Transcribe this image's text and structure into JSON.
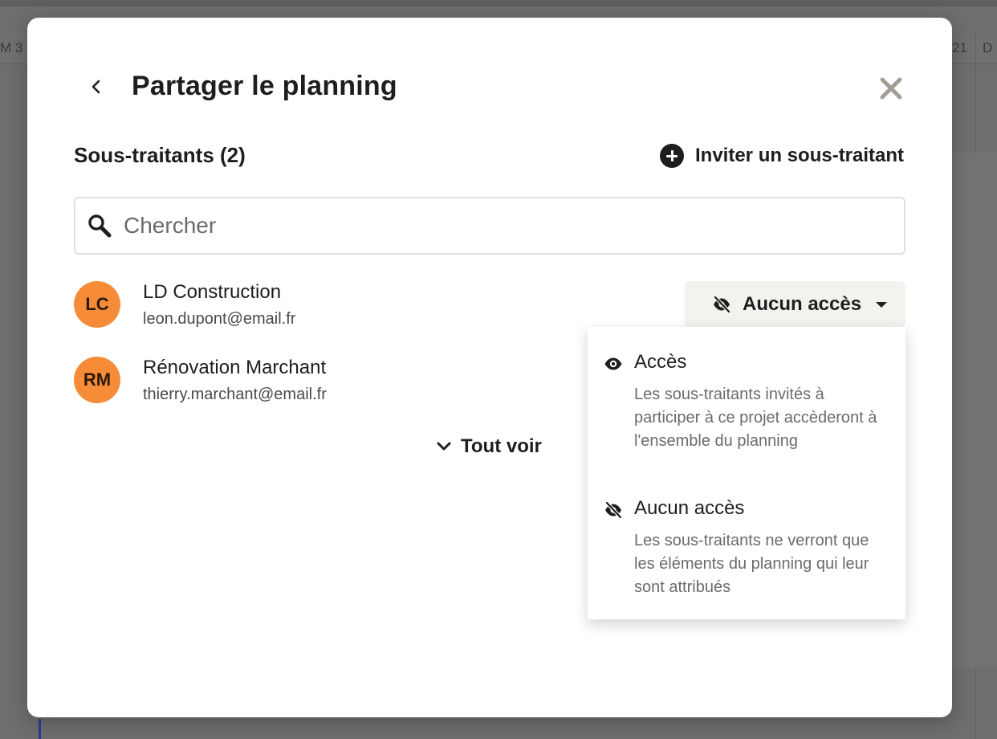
{
  "background": {
    "day_left": "M 3",
    "day_right_1": "21",
    "day_right_2": "D"
  },
  "modal": {
    "title": "Partager le planning",
    "section_title": "Sous-traitants (2)",
    "invite_label": "Inviter un sous-traitant",
    "search_placeholder": "Chercher",
    "members": [
      {
        "initials": "LC",
        "name": "LD Construction",
        "email": "leon.dupont@email.fr"
      },
      {
        "initials": "RM",
        "name": "Rénovation Marchant",
        "email": "thierry.marchant@email.fr"
      }
    ],
    "access_select": {
      "selected": "Aucun accès"
    },
    "see_all": "Tout voir",
    "dropdown": {
      "options": [
        {
          "title": "Accès",
          "description": "Les sous-traitants invités à participer à ce projet accèderont à l'ensemble du planning",
          "icon": "eye-icon"
        },
        {
          "title": "Aucun accès",
          "description": "Les sous-traitants ne verront que les éléments du planning qui leur sont attribués",
          "icon": "eye-off-icon"
        }
      ]
    }
  },
  "colors": {
    "avatar_bg": "#f68b38",
    "text_primary": "#1e1e1e",
    "text_secondary": "#6b6b6b",
    "overlay": "#6b6b6b",
    "select_bg": "#f3f2ef"
  }
}
